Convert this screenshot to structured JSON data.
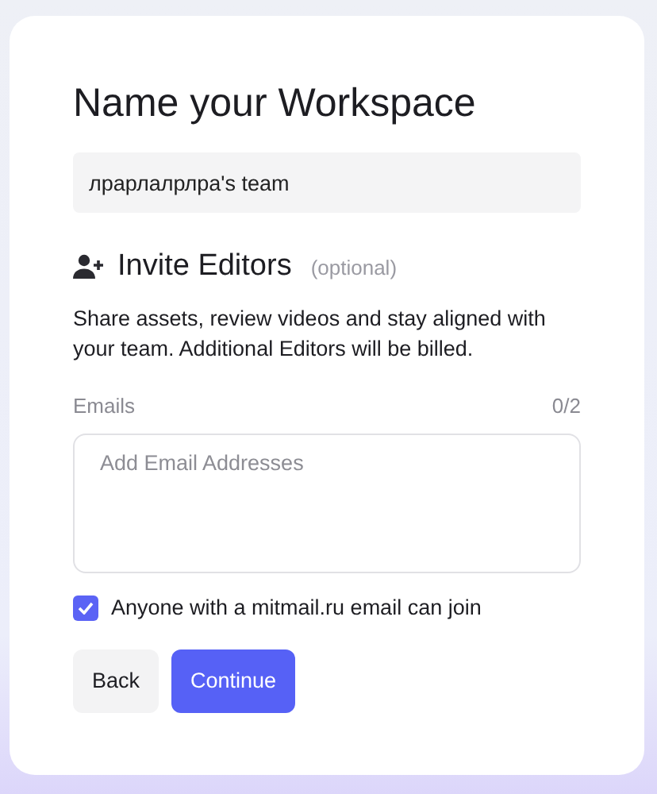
{
  "title": "Name your Workspace",
  "workspace_name": {
    "value": "лрарлалрлра's team"
  },
  "invite": {
    "heading": "Invite Editors",
    "note": "(optional)",
    "description": "Share assets, review videos and stay aligned with your team. Additional Editors will be billed."
  },
  "emails": {
    "label": "Emails",
    "count": "0/2",
    "placeholder": "Add Email Addresses"
  },
  "domain_join": {
    "label": "Anyone with a mitmail.ru email can join",
    "checked": true
  },
  "buttons": [
    {
      "label": "Back",
      "kind": "secondary"
    },
    {
      "label": "Continue",
      "kind": "primary"
    }
  ]
}
